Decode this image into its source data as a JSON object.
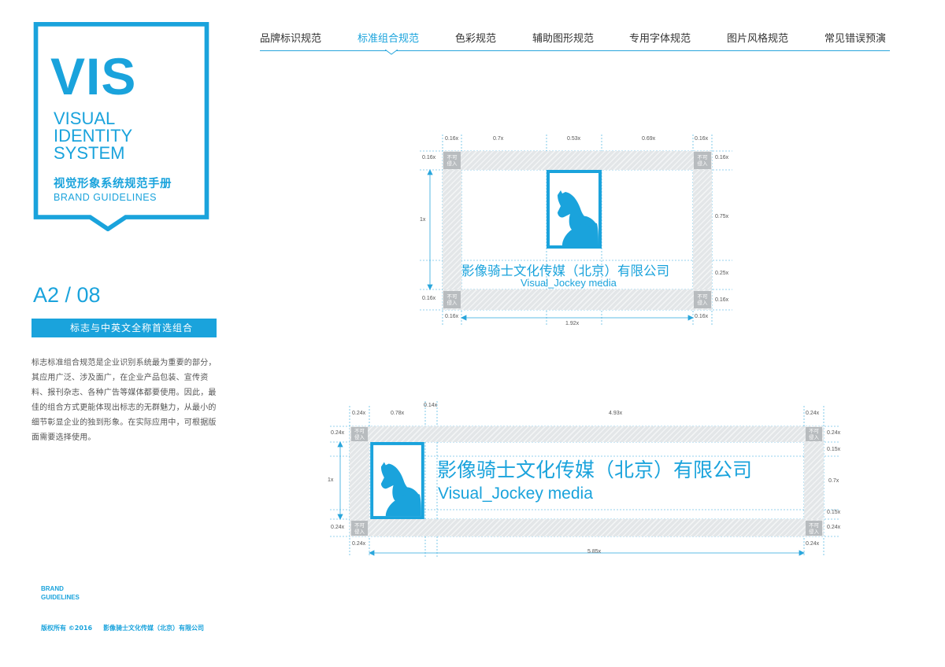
{
  "cover": {
    "title": "VIS",
    "subtitle_lines": [
      "VISUAL",
      "IDENTITY",
      "SYSTEM"
    ],
    "title_cn": "视觉形象系统规范手册",
    "title_en": "BRAND GUIDELINES"
  },
  "nav": {
    "items": [
      {
        "label": "品牌标识规范"
      },
      {
        "label": "标准组合规范"
      },
      {
        "label": "色彩规范"
      },
      {
        "label": "辅助图形规范"
      },
      {
        "label": "专用字体规范"
      },
      {
        "label": "图片风格规范"
      },
      {
        "label": "常见错误预演"
      }
    ],
    "active_index": 1
  },
  "page": {
    "number": "A2 / 08",
    "section_title": "标志与中英文全称首选组合",
    "description": [
      "标志标准组合规范是企业识别系统最为重要的部分，",
      "其应用广泛、涉及面广，在企业产品包装、宣传资",
      "料、报刊杂志、各种广告等媒体都要使用。因此，最",
      "佳的组合方式更能体现出标志的无群魅力，从最小的",
      "细节彰显企业的独到形象。在实际应用中，可根据版",
      "面需要选择使用。"
    ]
  },
  "footer": {
    "brand_line1": "BRAND",
    "brand_line2": "GUIDELINES",
    "copyright": "版权所有 ©2016",
    "company": "影像骑士文化传媒（北京）有限公司"
  },
  "no_intrusion_label_1": "不可",
  "no_intrusion_label_2": "侵入",
  "company_cn": "影像骑士文化传媒（北京）有限公司",
  "company_en": "Visual_Jockey media",
  "diagram_vertical": {
    "top_dims": [
      "0.16x",
      "0.7x",
      "0.53x",
      "0.69x",
      "0.16x"
    ],
    "left_dims": [
      "0.16x",
      "1x",
      "0.16x"
    ],
    "right_dims": [
      "0.16x",
      "0.75x",
      "0.25x",
      "0.16x"
    ],
    "bottom_dims": [
      "0.16x",
      "1.92x",
      "0.16x"
    ]
  },
  "diagram_horizontal": {
    "top_dims": [
      "0.24x",
      "0.78x",
      "0.14x",
      "4.93x",
      "0.24x"
    ],
    "left_dims": [
      "0.24x",
      "1x",
      "0.24x"
    ],
    "right_dims": [
      "0.24x",
      "0.15x",
      "0.7x",
      "0.15x",
      "0.24x"
    ],
    "bottom_dims": [
      "0.24x",
      "5.85x",
      "0.24x"
    ]
  },
  "colors": {
    "brand_blue": "#1aa3dc",
    "hatch_gray": "#e3e6e8",
    "corner_gray": "#b8bcbf"
  }
}
